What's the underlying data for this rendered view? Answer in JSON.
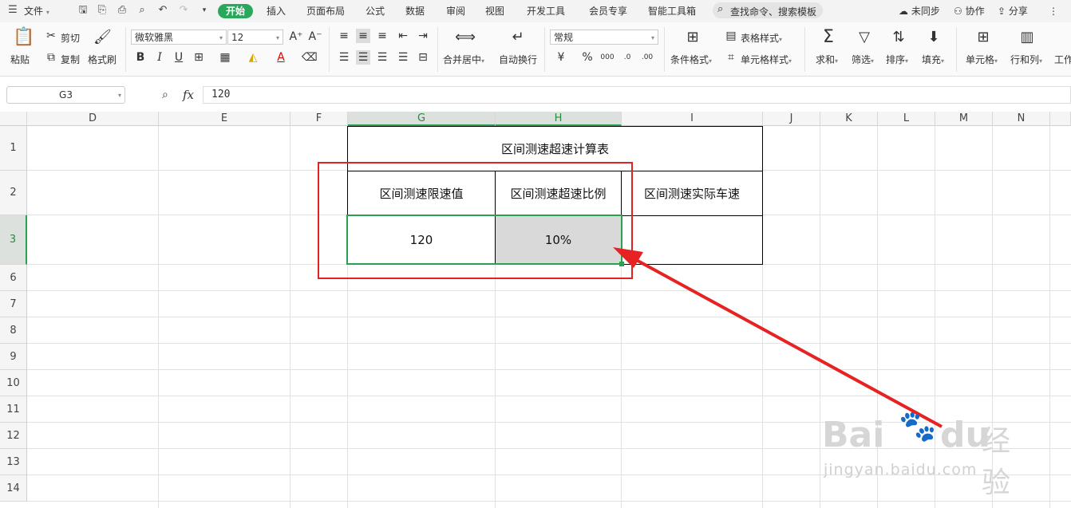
{
  "ribbon": {
    "file_menu": "文件",
    "tabs": [
      "开始",
      "插入",
      "页面布局",
      "公式",
      "数据",
      "审阅",
      "视图",
      "开发工具",
      "会员专享",
      "智能工具箱"
    ],
    "search_label": "查找命令、搜索模板",
    "sync": "未同步",
    "collab": "协作",
    "share": "分享"
  },
  "toolbar": {
    "paste": "粘贴",
    "cut": "剪切",
    "copy": "复制",
    "format_painter": "格式刷",
    "font_name": "微软雅黑",
    "font_size": "12",
    "merge_center": "合并居中",
    "wrap_text": "自动换行",
    "number_format": "常规",
    "cond_format": "条件格式",
    "table_style": "表格样式",
    "cell_style": "单元格样式",
    "sum": "求和",
    "filter": "筛选",
    "sort": "排序",
    "fill": "填充",
    "cell": "单元格",
    "row_col": "行和列",
    "worksheet": "工作"
  },
  "formula_bar": {
    "name_box": "G3",
    "fx": "fx",
    "value": "120"
  },
  "sheet": {
    "columns": [
      "D",
      "E",
      "F",
      "G",
      "H",
      "I",
      "J",
      "K",
      "L",
      "M",
      "N"
    ],
    "rows": [
      "1",
      "2",
      "3",
      "6",
      "7",
      "8",
      "9",
      "10",
      "11",
      "12",
      "13",
      "14"
    ],
    "table_title": "区间测速超速计算表",
    "headers": [
      "区间测速限速值",
      "区间测速超速比例",
      "区间测速实际车速"
    ],
    "values": [
      "120",
      "10%",
      ""
    ]
  },
  "watermark": {
    "brand": "Bai",
    "brand2": "du",
    "cn": "经验",
    "url": "jingyan.baidu.com"
  }
}
